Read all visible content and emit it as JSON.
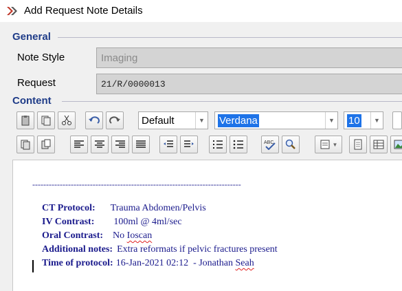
{
  "window": {
    "title": "Add Request Note Details"
  },
  "sections": {
    "general": "General",
    "content": "Content"
  },
  "fields": {
    "note_style_label": "Note Style",
    "note_style_value": "Imaging",
    "request_label": "Request",
    "request_value": "21/R/0000013"
  },
  "toolbar": {
    "style_combo": "Default",
    "font_combo": "Verdana",
    "size_combo": "10",
    "icons_row1": [
      "paste-icon",
      "copy-icon",
      "cut-icon",
      "undo-icon",
      "redo-icon"
    ],
    "icons_row2": [
      "copy-format-icon",
      "paste-format-icon",
      "align-left-icon",
      "align-center-icon",
      "align-right-icon",
      "justify-icon",
      "outdent-icon",
      "indent-icon",
      "numbered-list-icon",
      "bullet-list-icon",
      "spellcheck-icon",
      "find-icon",
      "insert-field-icon",
      "page-icon",
      "table-icon",
      "image-icon"
    ]
  },
  "editor": {
    "separator": "----------------------------------------------------------------------------",
    "lines": [
      {
        "label": "CT Protocol:",
        "value": "Trauma Abdomen/Pelvis"
      },
      {
        "label": "IV Contrast:",
        "value": "100ml @ 4ml/sec"
      },
      {
        "label": "Oral Contrast:",
        "value_prefix": "No ",
        "value_misspelled": "Ioscan"
      },
      {
        "label": "Additional notes:",
        "value": "Extra reformats if pelvic fractures present"
      },
      {
        "label": "Time of protocol:",
        "value_prefix": "16-Jan-2021 02:12  - Jonathan ",
        "value_misspelled": "Seah"
      }
    ]
  },
  "colors": {
    "section_header": "#1f3c88",
    "editor_text": "#1a1a8c",
    "selection": "#1e73e8",
    "spell_error": "#e02020"
  }
}
